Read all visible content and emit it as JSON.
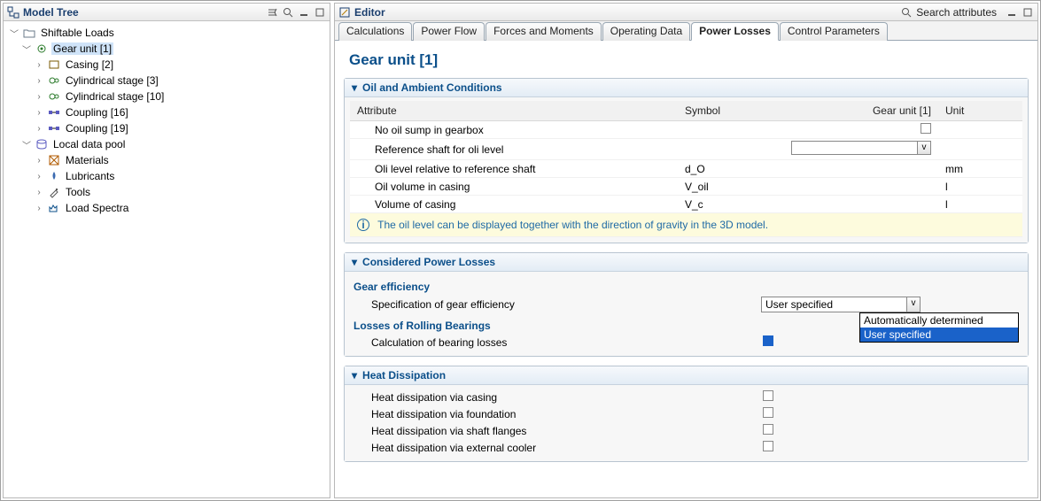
{
  "left": {
    "title": "Model Tree",
    "root": "Shiftable Loads",
    "gearUnit": "Gear unit [1]",
    "children": [
      "Casing [2]",
      "Cylindrical stage [3]",
      "Cylindrical stage [10]",
      "Coupling [16]",
      "Coupling [19]"
    ],
    "pool": "Local data pool",
    "poolItems": [
      "Materials",
      "Lubricants",
      "Tools",
      "Load Spectra"
    ]
  },
  "right": {
    "title": "Editor",
    "search": "Search attributes",
    "tabs": [
      "Calculations",
      "Power Flow",
      "Forces and Moments",
      "Operating Data",
      "Power Losses",
      "Control Parameters"
    ],
    "activeTab": 4,
    "page": "Gear unit [1]",
    "sec1": {
      "title": "Oil and Ambient Conditions",
      "cols": [
        "Attribute",
        "Symbol",
        "Gear unit [1]",
        "Unit"
      ],
      "rows": [
        {
          "a": "No oil sump in gearbox",
          "s": "",
          "type": "check"
        },
        {
          "a": "Reference shaft for oli level",
          "s": "",
          "type": "combo"
        },
        {
          "a": "Oli level relative to reference shaft",
          "s": "d_O",
          "u": "mm"
        },
        {
          "a": "Oil volume in casing",
          "s": "V_oil",
          "u": "l"
        },
        {
          "a": "Volume of casing",
          "s": "V_c",
          "u": "l"
        }
      ],
      "info": "The oil level can be displayed together with the direction of gravity in the 3D model."
    },
    "sec2": {
      "title": "Considered Power Losses",
      "gearEff": "Gear efficiency",
      "spec": "Specification of gear efficiency",
      "specValue": "User specified",
      "options": [
        "Automatically determined",
        "User specified"
      ],
      "lossesHdr": "Losses of Rolling Bearings",
      "calc": "Calculation of bearing losses"
    },
    "sec3": {
      "title": "Heat Dissipation",
      "rows": [
        "Heat dissipation via casing",
        "Heat dissipation via foundation",
        "Heat dissipation via shaft flanges",
        "Heat dissipation via external cooler"
      ]
    }
  }
}
